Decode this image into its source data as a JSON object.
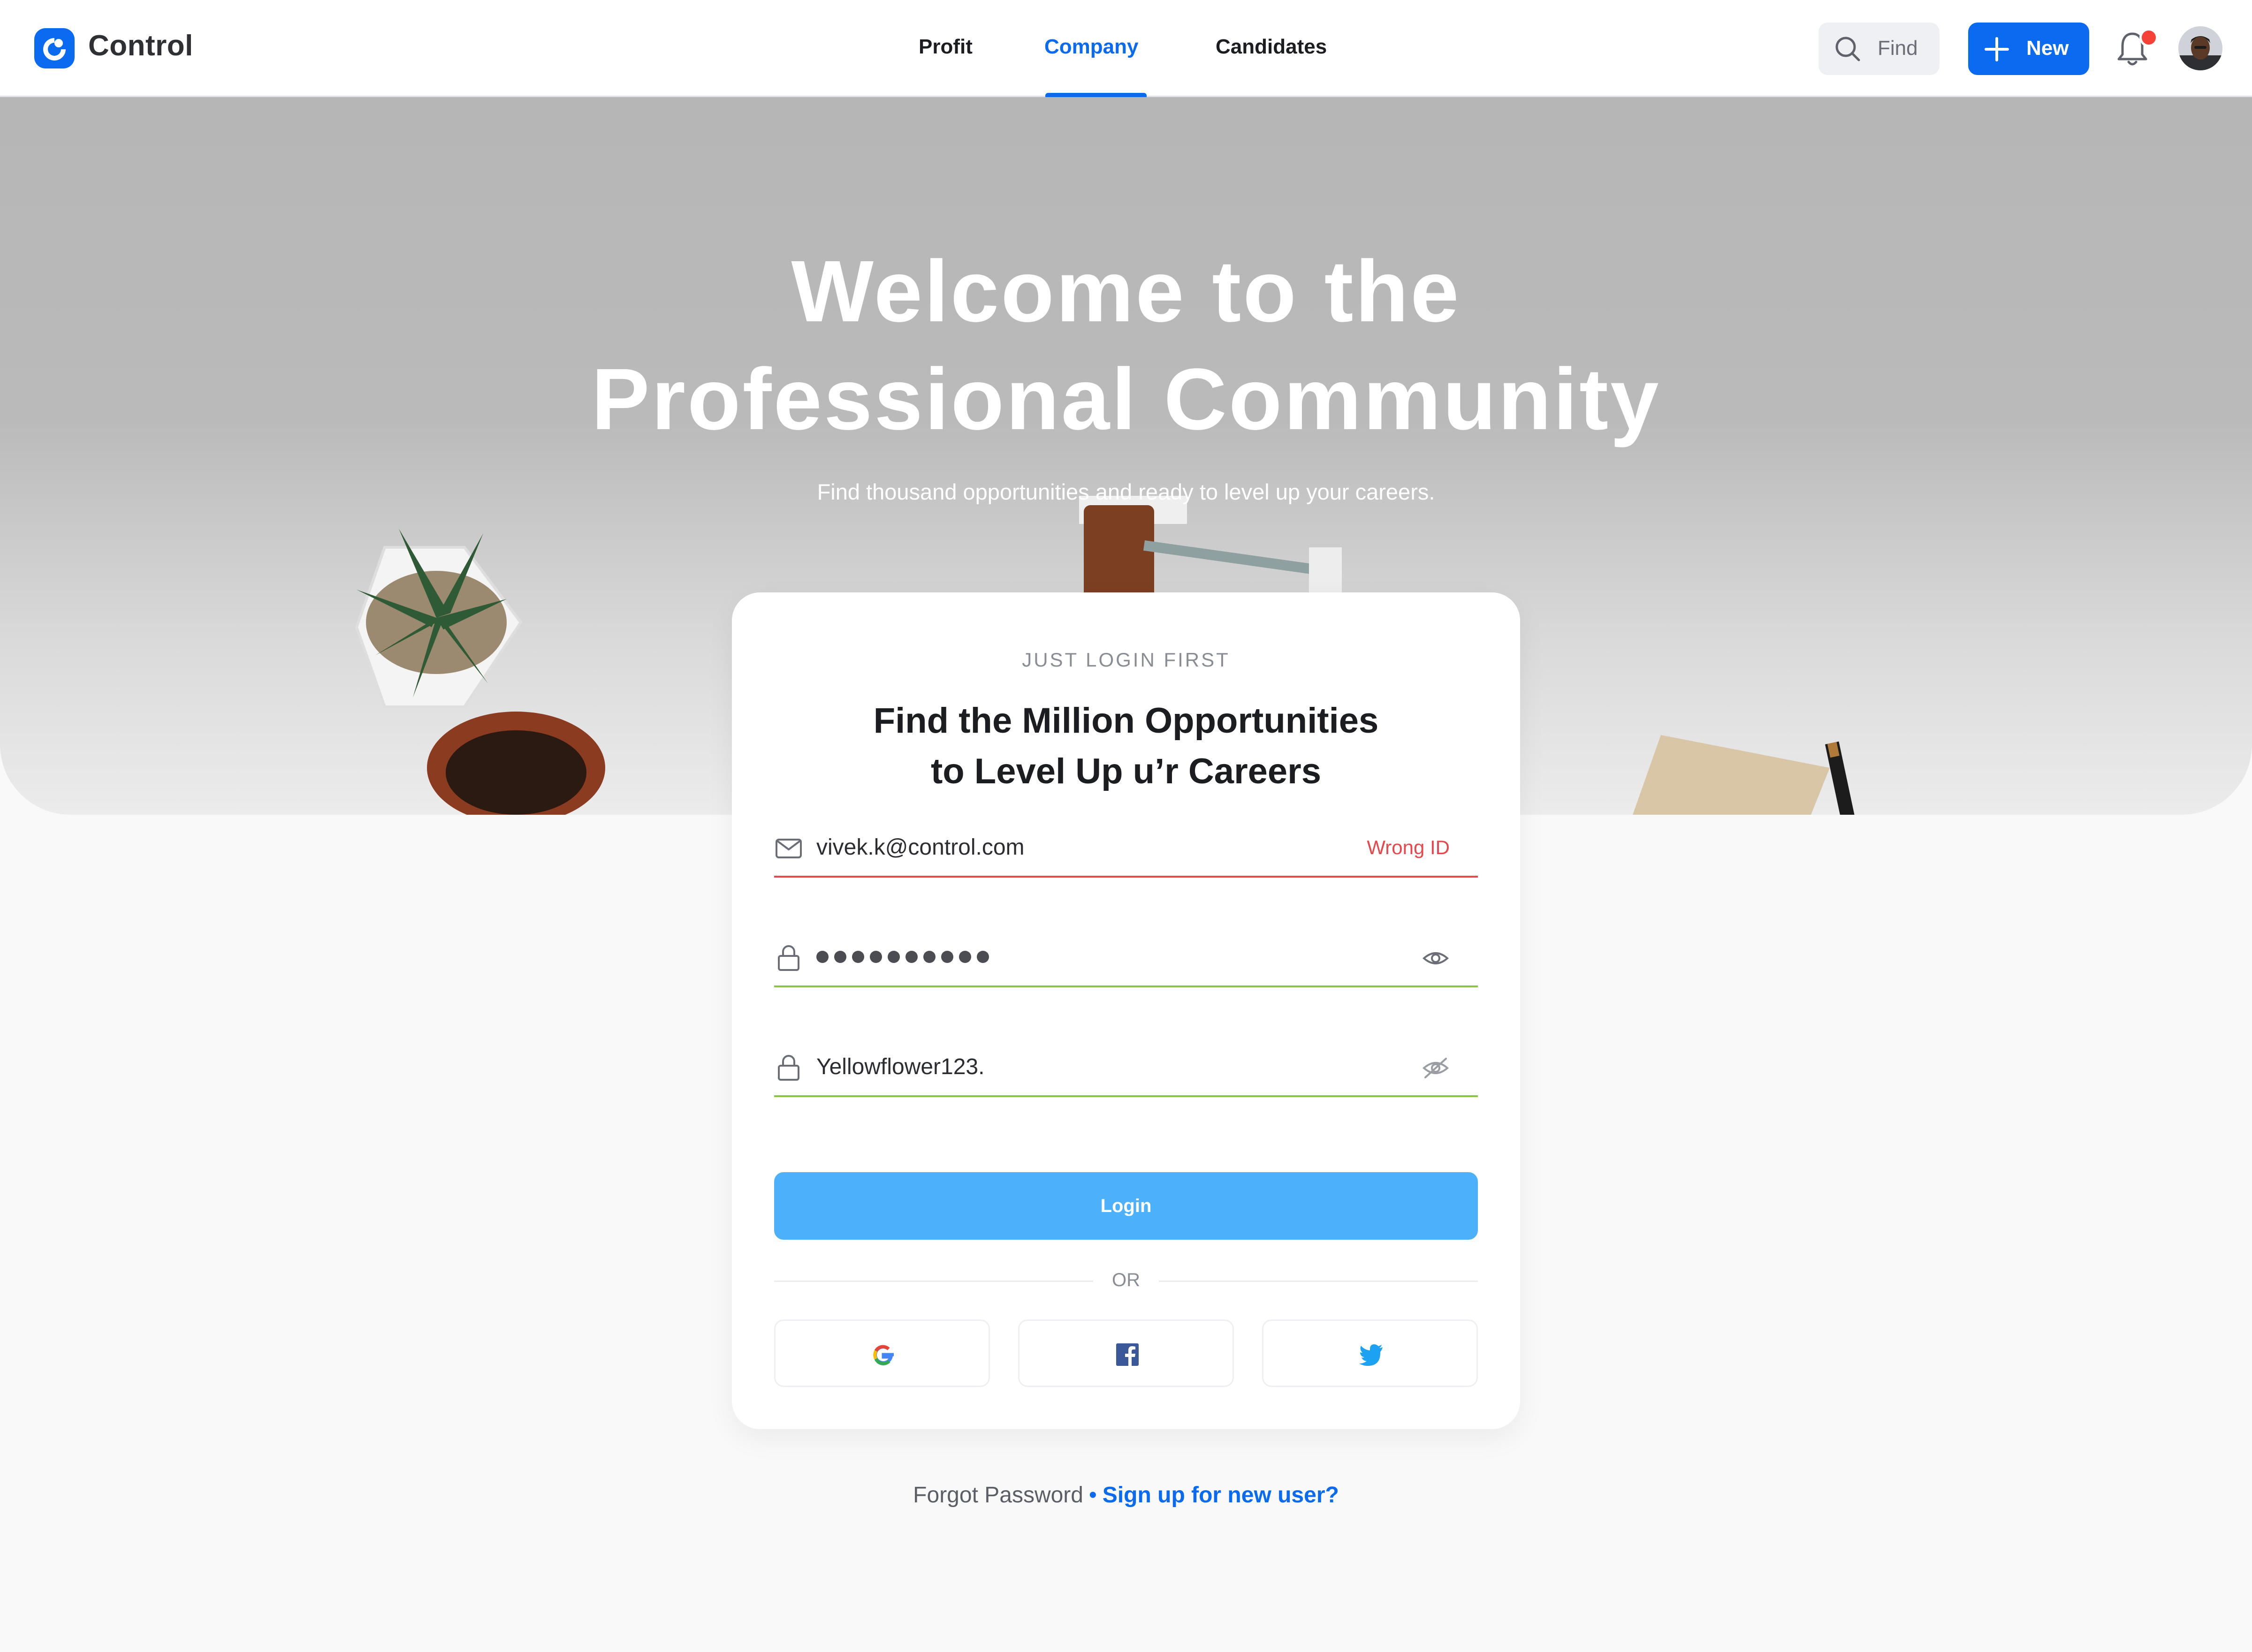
{
  "app": {
    "name": "Control"
  },
  "nav": {
    "items": [
      {
        "label": "Profit"
      },
      {
        "label": "Company"
      },
      {
        "label": "Candidates"
      }
    ],
    "active": "Company"
  },
  "header": {
    "search_placeholder": "Find",
    "new_button": "New",
    "notification_badge": true,
    "colors": {
      "accent": "#0b6bf0",
      "badge": "#f44336"
    }
  },
  "hero": {
    "title_line1": "Welcome to the",
    "title_line2": "Professional Community",
    "subtitle": "Find thousand opportunities and ready to level up your careers."
  },
  "login": {
    "eyebrow": "JUST LOGIN FIRST",
    "title_line1": "Find the Million Opportunities",
    "title_line2": "to Level Up u’r Careers",
    "email": {
      "icon": "mail-icon",
      "value": "vivek.k@control.com",
      "error": "Wrong ID",
      "state_color": "#e5484d"
    },
    "password_hidden": {
      "icon": "lock-icon",
      "masked_length": 10,
      "toggle_icon": "eye-icon",
      "state_color": "#8bc34a"
    },
    "password_visible": {
      "icon": "lock-icon",
      "value": "Yellowflower123.",
      "toggle_icon": "eye-off-icon",
      "state_color": "#8bc34a"
    },
    "login_button": "Login",
    "login_button_color": "#4db0fb",
    "divider_text": "OR",
    "social": [
      "google-icon",
      "facebook-icon",
      "twitter-icon"
    ]
  },
  "footer": {
    "forgot": "Forgot Password",
    "separator": "•",
    "signup": "Sign up for new user?"
  }
}
